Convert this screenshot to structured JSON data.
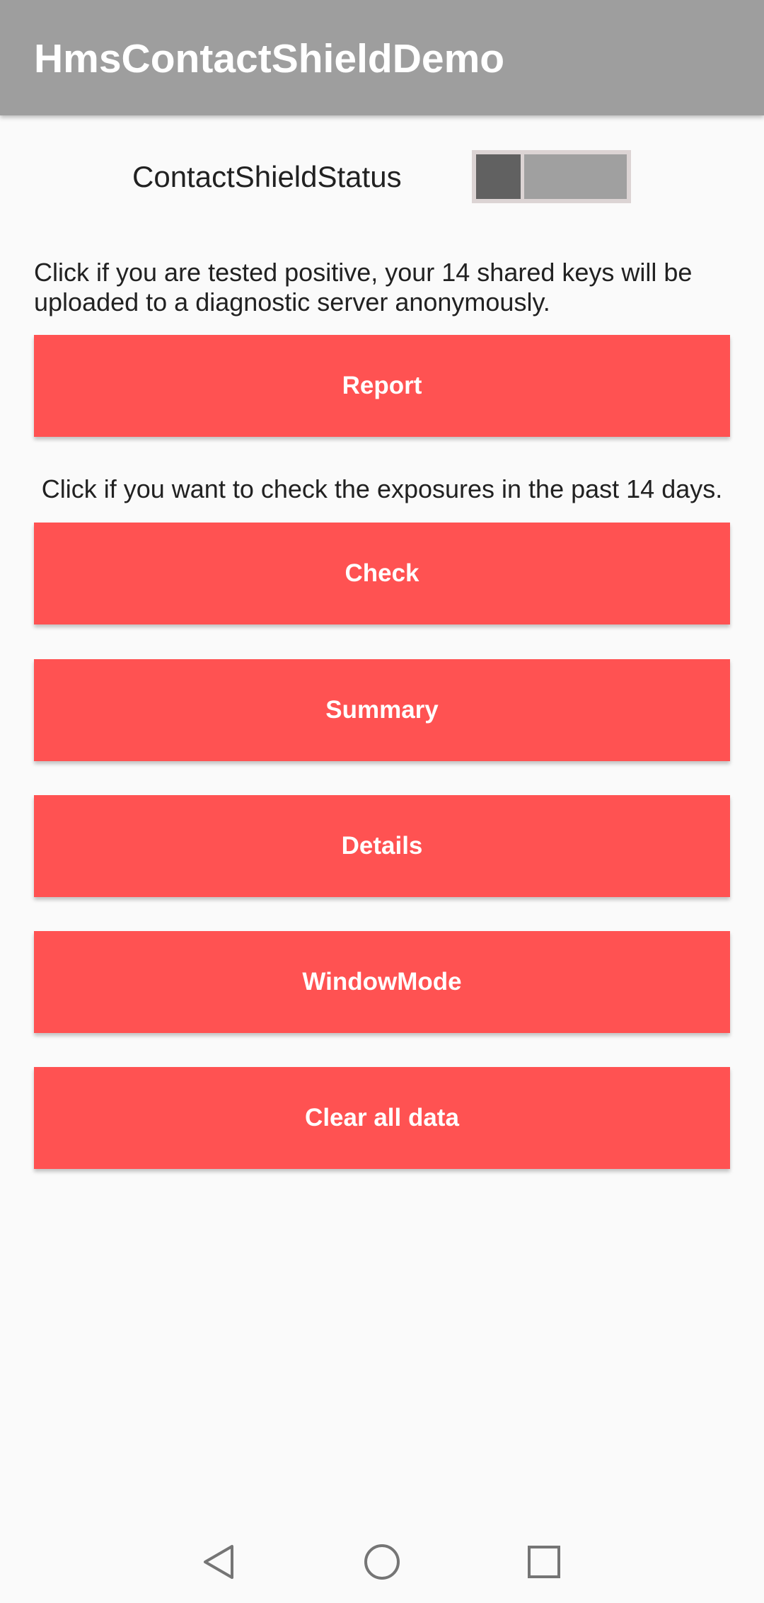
{
  "app_bar": {
    "title": "HmsContactShieldDemo"
  },
  "status": {
    "label": "ContactShieldStatus",
    "switch_on": false
  },
  "report_section": {
    "description": "Click if you are tested positive, your 14 shared keys will be uploaded to a diagnostic server anonymously.",
    "button_label": "Report"
  },
  "check_section": {
    "description": "Click if you want to check the exposures in the past 14 days.",
    "buttons": {
      "check": "Check",
      "summary": "Summary",
      "details": "Details",
      "window_mode": "WindowMode",
      "clear_all": "Clear all data"
    }
  },
  "nav_bar": {
    "back_icon": "back-triangle",
    "home_icon": "home-circle",
    "recent_icon": "recent-square"
  },
  "colors": {
    "app_bar": "#9e9e9e",
    "button": "#ff5252",
    "background": "#fafafa",
    "switch_thumb": "#616161",
    "switch_track": "#a0a0a0"
  }
}
